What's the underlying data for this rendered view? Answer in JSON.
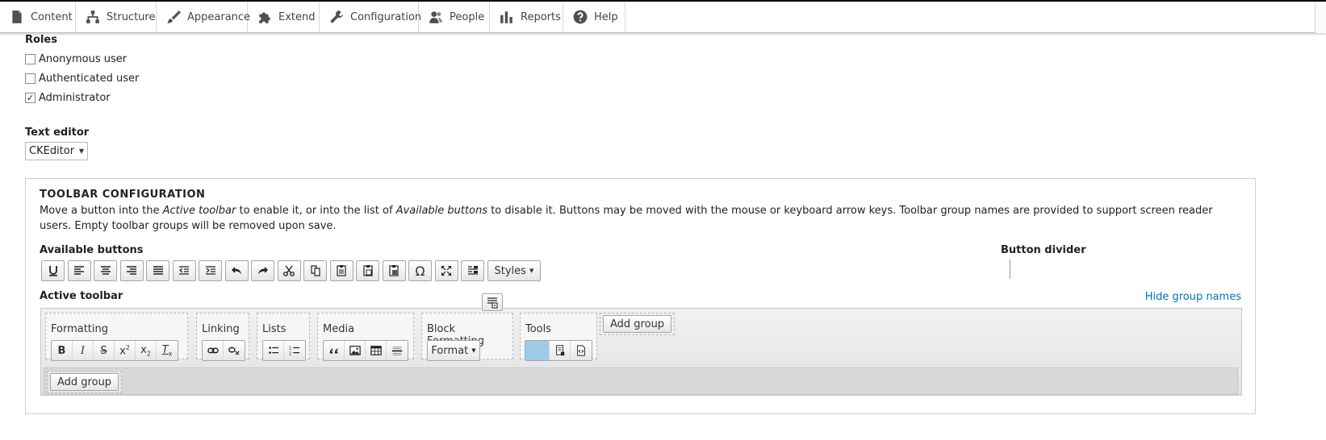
{
  "admin_toolbar": {
    "items": [
      {
        "label": "Content",
        "icon": "page-icon"
      },
      {
        "label": "Structure",
        "icon": "sitemap-icon"
      },
      {
        "label": "Appearance",
        "icon": "paintbrush-icon"
      },
      {
        "label": "Extend",
        "icon": "puzzle-icon"
      },
      {
        "label": "Configuration",
        "icon": "wrench-icon"
      },
      {
        "label": "People",
        "icon": "people-icon"
      },
      {
        "label": "Reports",
        "icon": "bar-chart-icon"
      },
      {
        "label": "Help",
        "icon": "help-icon"
      }
    ]
  },
  "roles": {
    "title": "Roles",
    "items": [
      {
        "label": "Anonymous user",
        "checked": false
      },
      {
        "label": "Authenticated user",
        "checked": false
      },
      {
        "label": "Administrator",
        "checked": true
      }
    ]
  },
  "text_editor": {
    "label": "Text editor",
    "selected": "CKEditor"
  },
  "toolbar_config": {
    "title": "TOOLBAR CONFIGURATION",
    "desc_1": "Move a button into the ",
    "desc_em_1": "Active toolbar",
    "desc_2": " to enable it, or into the list of ",
    "desc_em_2": "Available buttons",
    "desc_3": " to disable it. Buttons may be moved with the mouse or keyboard arrow keys. Toolbar group names are provided to support screen reader users. Empty toolbar groups will be removed upon save.",
    "available_label": "Available buttons",
    "divider_label": "Button divider",
    "styles_label": "Styles",
    "active_label": "Active toolbar",
    "hide_group_names": "Hide group names",
    "add_group": "Add group",
    "groups": {
      "formatting": "Formatting",
      "linking": "Linking",
      "lists": "Lists",
      "media": "Media",
      "block_formatting": "Block Formatting",
      "tools": "Tools"
    },
    "format_label": "Format",
    "omega_glyph": "Ω"
  }
}
